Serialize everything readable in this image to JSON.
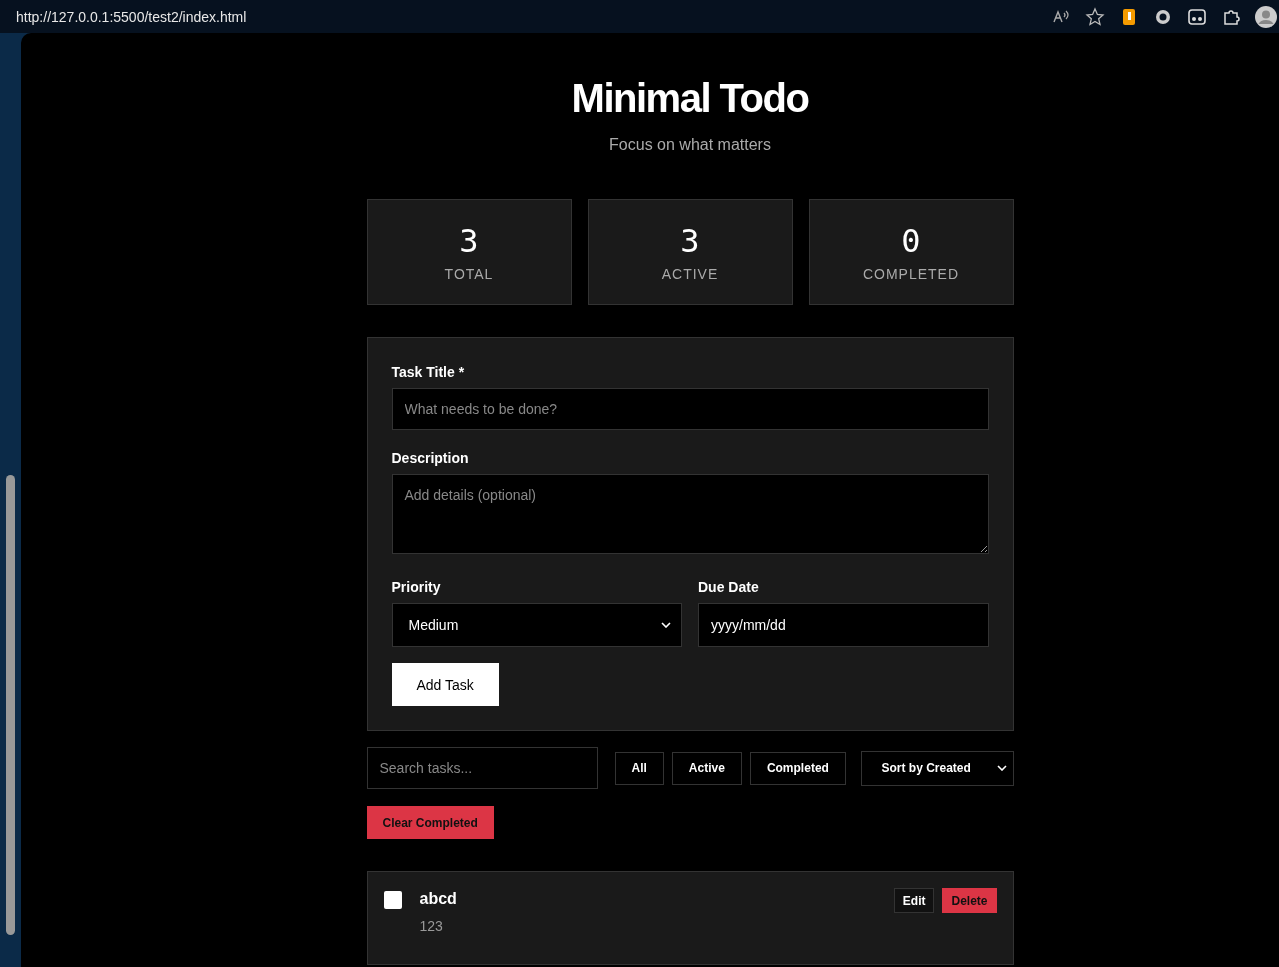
{
  "browser": {
    "url": "http://127.0.0.1:5500/test2/index.html"
  },
  "header": {
    "title": "Minimal Todo",
    "subtitle": "Focus on what matters"
  },
  "stats": [
    {
      "value": "3",
      "label": "TOTAL"
    },
    {
      "value": "3",
      "label": "ACTIVE"
    },
    {
      "value": "0",
      "label": "COMPLETED"
    }
  ],
  "form": {
    "title_label": "Task Title *",
    "title_placeholder": "What needs to be done?",
    "description_label": "Description",
    "description_placeholder": "Add details (optional)",
    "priority_label": "Priority",
    "priority_value": "Medium",
    "due_label": "Due Date",
    "due_value": "yyyy/mm/dd",
    "submit": "Add Task"
  },
  "toolbar": {
    "search_placeholder": "Search tasks...",
    "filters": [
      "All",
      "Active",
      "Completed"
    ],
    "sort_value": "Sort by Created",
    "clear": "Clear Completed"
  },
  "tasks": [
    {
      "title": "abcd",
      "description": "123",
      "checked": false,
      "edit": "Edit",
      "delete": "Delete"
    }
  ]
}
